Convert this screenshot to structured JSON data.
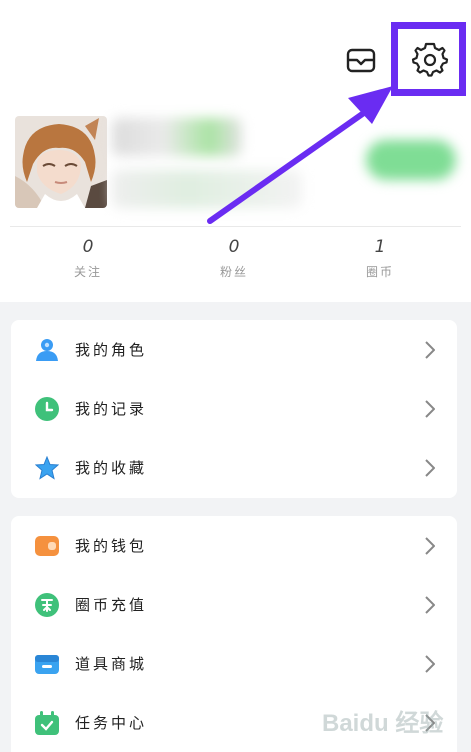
{
  "header": {
    "mail_icon": "mail-icon",
    "settings_icon": "gear-icon"
  },
  "stats": [
    {
      "value": "0",
      "label": "关注"
    },
    {
      "value": "0",
      "label": "粉丝"
    },
    {
      "value": "1",
      "label": "圈币"
    }
  ],
  "menu_groups": [
    {
      "items": [
        {
          "label": "我的角色",
          "icon": "person-icon",
          "color": "#3a9cf4"
        },
        {
          "label": "我的记录",
          "icon": "clock-icon",
          "color": "#3fc17a"
        },
        {
          "label": "我的收藏",
          "icon": "star-icon",
          "color": "#3aa3f0"
        }
      ]
    },
    {
      "items": [
        {
          "label": "我的钱包",
          "icon": "wallet-icon",
          "color": "#f5913e"
        },
        {
          "label": "圈币充值",
          "icon": "coin-icon",
          "color": "#3fc17a"
        },
        {
          "label": "道具商城",
          "icon": "store-icon",
          "color": "#3aa3f0"
        },
        {
          "label": "任务中心",
          "icon": "calendar-check-icon",
          "color": "#3fc17a"
        }
      ]
    }
  ],
  "colors": {
    "highlight": "#6a2cf2",
    "background": "#f2f3f5"
  },
  "watermark": "Baidu 经验"
}
